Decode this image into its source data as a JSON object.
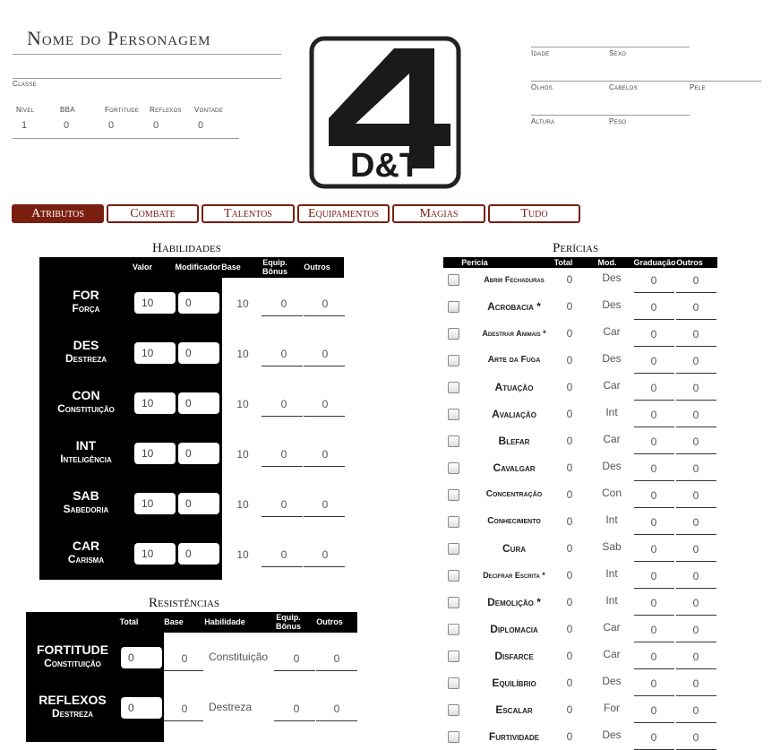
{
  "character": {
    "name_placeholder": "Nome do Personagem",
    "class_label": "Classe",
    "level_label": "Nível",
    "level": "1",
    "bba_label": "BBA",
    "bba": "0",
    "fort_label": "Fortitude",
    "fort": "0",
    "ref_label": "Reflexos",
    "ref": "0",
    "will_label": "Vontade",
    "will": "0"
  },
  "details": {
    "idade": "Idade",
    "sexo": "Sexo",
    "olhos": "Olhos",
    "cabelos": "Cabelos",
    "pele": "Pele",
    "altura": "Altura",
    "peso": "Peso"
  },
  "logo": {
    "top": "4",
    "bottom": "D&T"
  },
  "tabs": [
    "Atributos",
    "Combate",
    "Talentos",
    "Equipamentos",
    "Magias",
    "Tudo"
  ],
  "abilities": {
    "title": "Habilidades",
    "headers": {
      "valor": "Valor",
      "modificador": "Modificador",
      "base": "Base",
      "equip": "Equip.",
      "bonus": "Bônus",
      "outros": "Outros"
    },
    "rows": [
      {
        "abbr": "FOR",
        "name": "Força",
        "valor": "10",
        "mod": "0",
        "base": "10",
        "equip": "0",
        "outros": "0"
      },
      {
        "abbr": "DES",
        "name": "Destreza",
        "valor": "10",
        "mod": "0",
        "base": "10",
        "equip": "0",
        "outros": "0"
      },
      {
        "abbr": "CON",
        "name": "Constituição",
        "valor": "10",
        "mod": "0",
        "base": "10",
        "equip": "0",
        "outros": "0"
      },
      {
        "abbr": "INT",
        "name": "Inteligência",
        "valor": "10",
        "mod": "0",
        "base": "10",
        "equip": "0",
        "outros": "0"
      },
      {
        "abbr": "SAB",
        "name": "Sabedoria",
        "valor": "10",
        "mod": "0",
        "base": "10",
        "equip": "0",
        "outros": "0"
      },
      {
        "abbr": "CAR",
        "name": "Carisma",
        "valor": "10",
        "mod": "0",
        "base": "10",
        "equip": "0",
        "outros": "0"
      }
    ]
  },
  "resistances": {
    "title": "Resistências",
    "headers": {
      "total": "Total",
      "base": "Base",
      "habilidade": "Habilidade",
      "equip": "Equip.",
      "bonus": "Bônus",
      "outros": "Outros"
    },
    "rows": [
      {
        "name": "FORTITUDE",
        "sub": "Constituição",
        "total": "0",
        "base": "0",
        "hab": "Constituição",
        "equip": "0",
        "outros": "0"
      },
      {
        "name": "REFLEXOS",
        "sub": "Destreza",
        "total": "0",
        "base": "0",
        "hab": "Destreza",
        "equip": "0",
        "outros": "0"
      }
    ]
  },
  "skills": {
    "title": "Perícias",
    "headers": {
      "pericia": "Perícia",
      "total": "Total",
      "mod": "Mod.",
      "graduacao": "Graduação",
      "outros": "Outros"
    },
    "rows": [
      {
        "name": "Abrir Fechaduras",
        "total": "0",
        "mod": "Des",
        "grad": "0",
        "outros": "0"
      },
      {
        "name": "Acrobacia *",
        "total": "0",
        "mod": "Des",
        "grad": "0",
        "outros": "0"
      },
      {
        "name": "Adestrar Animais *",
        "total": "0",
        "mod": "Car",
        "grad": "0",
        "outros": "0"
      },
      {
        "name": "Arte da Fuga",
        "total": "0",
        "mod": "Des",
        "grad": "0",
        "outros": "0"
      },
      {
        "name": "Atuação",
        "total": "0",
        "mod": "Car",
        "grad": "0",
        "outros": "0"
      },
      {
        "name": "Avaliação",
        "total": "0",
        "mod": "Int",
        "grad": "0",
        "outros": "0"
      },
      {
        "name": "Blefar",
        "total": "0",
        "mod": "Car",
        "grad": "0",
        "outros": "0"
      },
      {
        "name": "Cavalgar",
        "total": "0",
        "mod": "Des",
        "grad": "0",
        "outros": "0"
      },
      {
        "name": "Concentração",
        "total": "0",
        "mod": "Con",
        "grad": "0",
        "outros": "0"
      },
      {
        "name": "Conhecimento",
        "total": "0",
        "mod": "Int",
        "grad": "0",
        "outros": "0"
      },
      {
        "name": "Cura",
        "total": "0",
        "mod": "Sab",
        "grad": "0",
        "outros": "0"
      },
      {
        "name": "Decifrar Escrita *",
        "total": "0",
        "mod": "Int",
        "grad": "0",
        "outros": "0"
      },
      {
        "name": "Demolição *",
        "total": "0",
        "mod": "Int",
        "grad": "0",
        "outros": "0"
      },
      {
        "name": "Diplomacia",
        "total": "0",
        "mod": "Car",
        "grad": "0",
        "outros": "0"
      },
      {
        "name": "Disfarce",
        "total": "0",
        "mod": "Car",
        "grad": "0",
        "outros": "0"
      },
      {
        "name": "Equilíbrio",
        "total": "0",
        "mod": "Des",
        "grad": "0",
        "outros": "0"
      },
      {
        "name": "Escalar",
        "total": "0",
        "mod": "For",
        "grad": "0",
        "outros": "0"
      },
      {
        "name": "Furtividade",
        "total": "0",
        "mod": "Des",
        "grad": "0",
        "outros": "0"
      }
    ]
  },
  "colors": {
    "accent": "#7a1e10",
    "panel": "#000000"
  }
}
